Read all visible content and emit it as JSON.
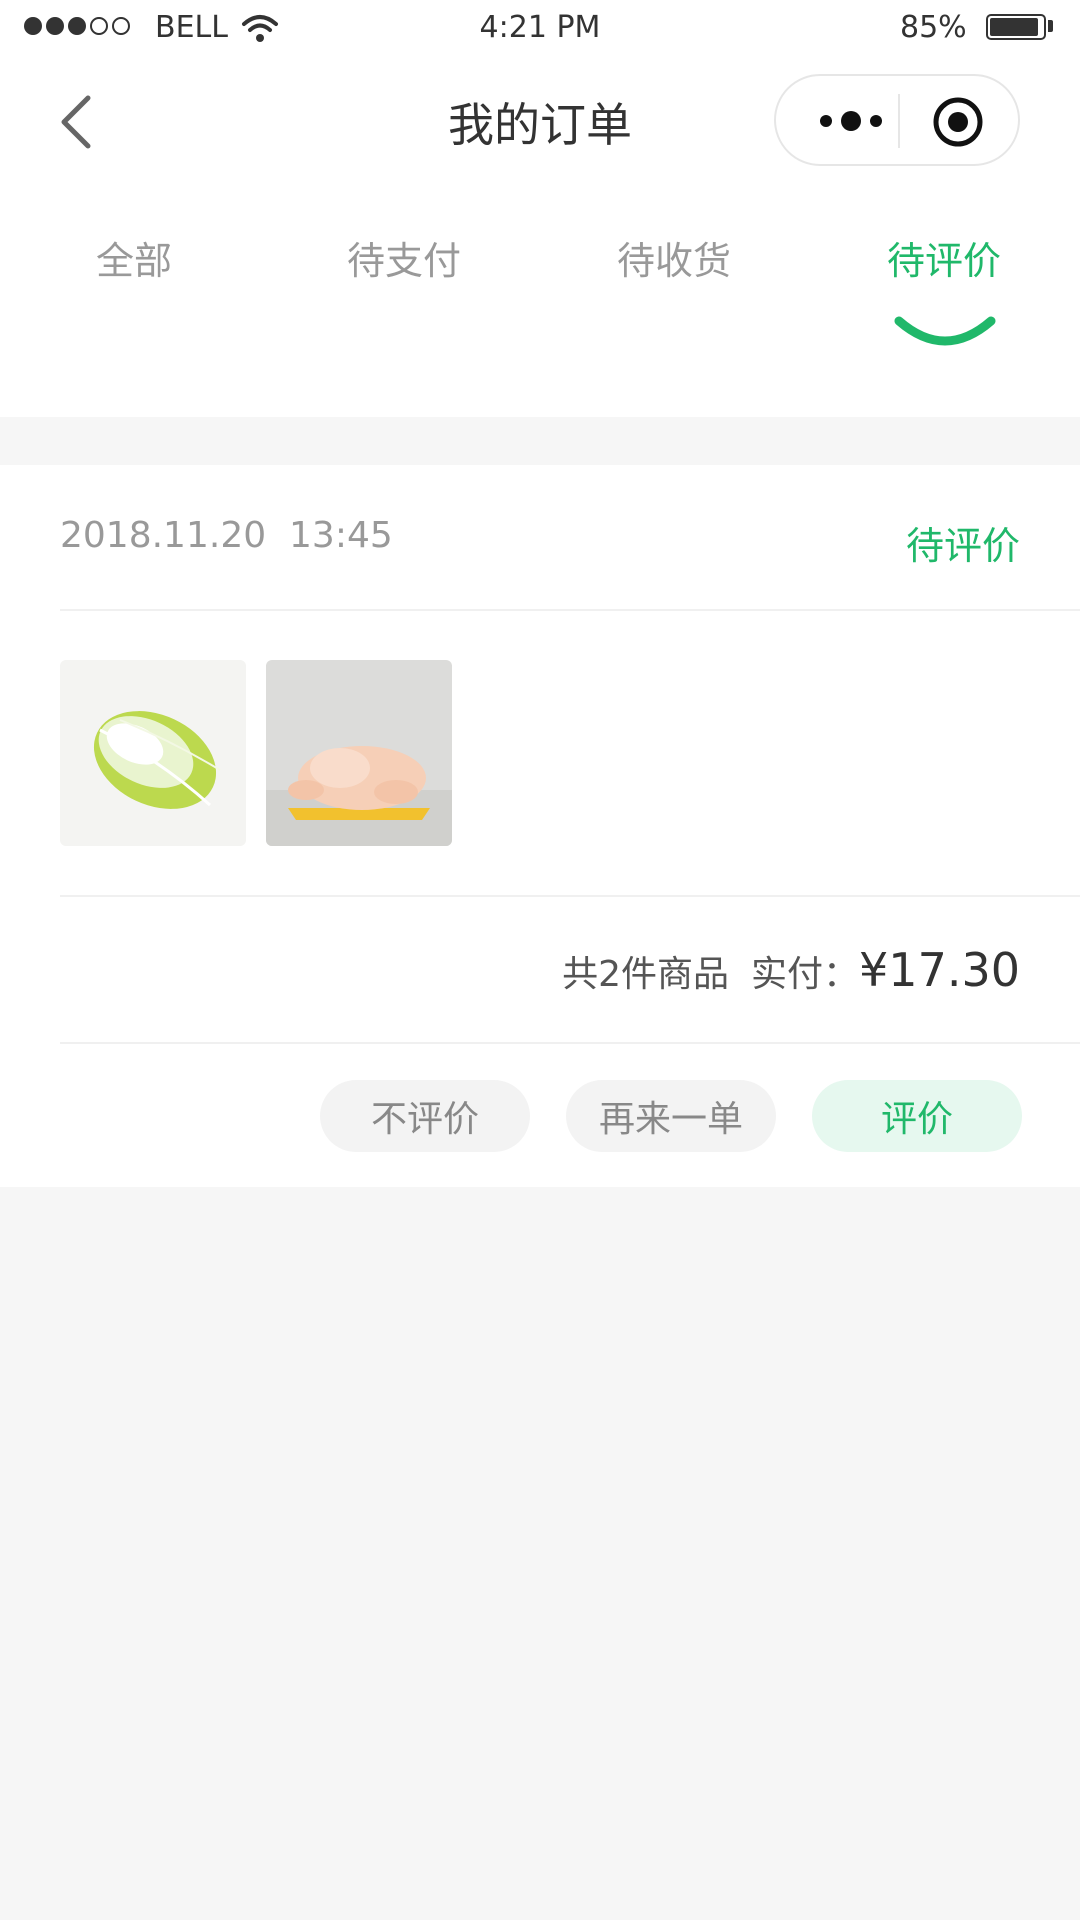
{
  "status_bar": {
    "carrier": "BELL",
    "time": "4:21 PM",
    "battery": "85%",
    "battery_level": 0.85,
    "signal_strength": 3,
    "signal_max": 5
  },
  "nav": {
    "title": "我的订单",
    "back_icon": "chevron-left-icon",
    "more_icon": "more-dots-icon",
    "close_icon": "target-circle-icon"
  },
  "tabs": [
    {
      "label": "全部"
    },
    {
      "label": "待支付"
    },
    {
      "label": "待收货"
    },
    {
      "label": "待评价",
      "active": true
    }
  ],
  "order": {
    "date": "2018.11.20",
    "time": "13:45",
    "status": "待评价",
    "items": [
      {
        "name": "napa-cabbage"
      },
      {
        "name": "whole-chicken"
      }
    ],
    "count_text": "共2件商品",
    "paid_label": "实付：",
    "paid_amount": "¥17.30",
    "actions": {
      "no_review": "不评价",
      "reorder": "再来一单",
      "review": "评价"
    }
  },
  "colors": {
    "accent": "#20b86a",
    "accent_light": "#e6f8ef",
    "background": "#f6f6f6"
  }
}
